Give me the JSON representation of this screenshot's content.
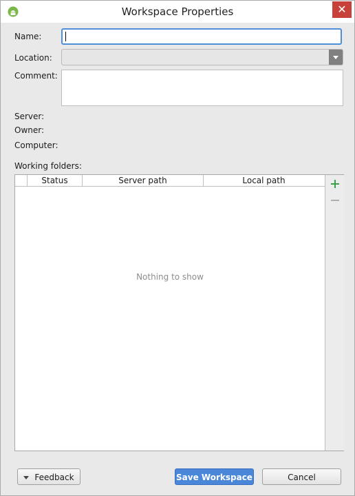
{
  "window": {
    "title": "Workspace Properties",
    "close_glyph": "✕"
  },
  "icons": {
    "app": "android-icon",
    "close": "close-icon",
    "add": "plus-icon",
    "remove": "minus-icon",
    "dropdown": "chevron-down-icon"
  },
  "form": {
    "name_label": "Name:",
    "name_value": "",
    "location_label": "Location:",
    "location_value": "",
    "comment_label": "Comment:",
    "comment_value": "",
    "server_label": "Server:",
    "owner_label": "Owner:",
    "computer_label": "Computer:"
  },
  "working_folders": {
    "label": "Working folders:",
    "columns": [
      "",
      "Status",
      "Server path",
      "Local path"
    ],
    "rows": [],
    "empty_text": "Nothing to show"
  },
  "buttons": {
    "feedback": "Feedback",
    "save": "Save Workspace",
    "cancel": "Cancel"
  },
  "colors": {
    "accent": "#4a87d9",
    "add_green": "#3aa04a",
    "close_red": "#c7413a"
  }
}
